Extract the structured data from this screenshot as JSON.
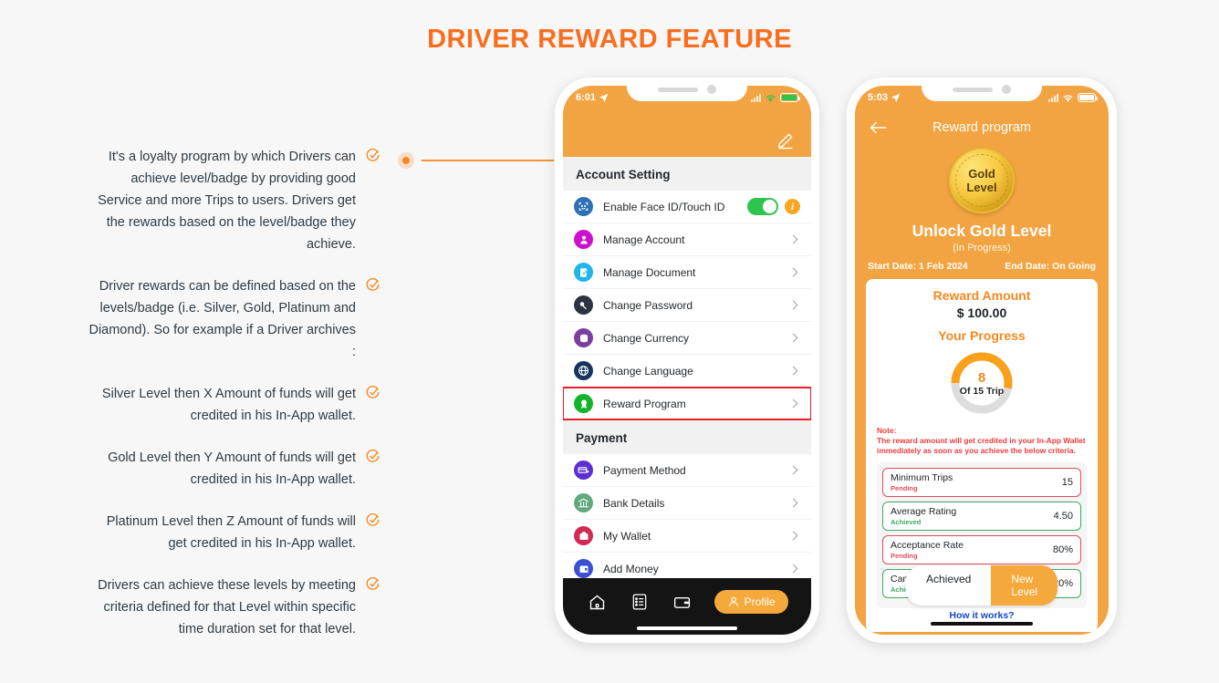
{
  "title": "DRIVER REWARD FEATURE",
  "accent_color": "#f96d1e",
  "bullets": [
    {
      "text": "It's a loyalty program by which Drivers can achieve level/badge by providing good Service and more Trips to users. Drivers get the rewards based on the level/badge they achieve."
    },
    {
      "text": "Driver rewards can be defined based on the levels/badge (i.e. Silver, Gold, Platinum and Diamond). So for example if a Driver archives :"
    },
    {
      "text": "Silver Level then X Amount of funds will get credited in his In-App wallet."
    },
    {
      "text": "Gold Level then Y Amount of funds will get credited in his In-App wallet."
    },
    {
      "text": "Platinum Level then Z Amount of funds will get credited in his In-App wallet."
    },
    {
      "text": "Drivers can achieve these levels by meeting criteria defined for that Level within specific time duration set for that level."
    }
  ],
  "phone1": {
    "status": {
      "time": "6:01",
      "battery_color": "#2ec44d"
    },
    "section1_title": "Account Setting",
    "section2_title": "Payment",
    "rows_account": [
      {
        "label": "Enable Face ID/Touch ID",
        "icon": "face-id-icon",
        "icon_color": "#2f6fb5",
        "control": "toggle"
      },
      {
        "label": "Manage Account",
        "icon": "person-icon",
        "icon_color": "#cc11cc",
        "control": "chevron"
      },
      {
        "label": "Manage Document",
        "icon": "document-edit-icon",
        "icon_color": "#1fb6ea",
        "control": "chevron"
      },
      {
        "label": "Change Password",
        "icon": "key-icon",
        "icon_color": "#2b3440",
        "control": "chevron"
      },
      {
        "label": "Change Currency",
        "icon": "currency-icon",
        "icon_color": "#7b3f9e",
        "control": "chevron"
      },
      {
        "label": "Change Language",
        "icon": "globe-icon",
        "icon_color": "#18355f",
        "control": "chevron"
      },
      {
        "label": "Reward Program",
        "icon": "reward-badge-icon",
        "icon_color": "#13b32a",
        "control": "chevron",
        "highlighted": true
      }
    ],
    "rows_payment": [
      {
        "label": "Payment Method",
        "icon": "card-swipe-icon",
        "icon_color": "#5b2fd1",
        "control": "chevron"
      },
      {
        "label": "Bank Details",
        "icon": "bank-icon",
        "icon_color": "#5fa97a",
        "control": "chevron"
      },
      {
        "label": "My Wallet",
        "icon": "wallet-icon",
        "icon_color": "#d02a55",
        "control": "chevron"
      },
      {
        "label": "Add Money",
        "icon": "add-money-icon",
        "icon_color": "#3a4fd1",
        "control": "chevron"
      }
    ],
    "tabbar": {
      "items": [
        "home-icon",
        "orders-icon",
        "wallet-icon"
      ],
      "profile_label": "Profile"
    }
  },
  "phone2": {
    "status": {
      "time": "5:03"
    },
    "nav_title": "Reward program",
    "badge_line1": "Gold",
    "badge_line2": "Level",
    "unlock_title": "Unlock Gold Level",
    "unlock_sub": "(In Progress)",
    "start_date": "Start Date: 1 Feb 2024",
    "end_date": "End Date: On Going",
    "reward_amount_label": "Reward Amount",
    "reward_amount_value": "$ 100.00",
    "progress_label": "Your Progress",
    "progress_current": "8",
    "progress_total_text": "Of 15 Trip",
    "progress_percent": 53,
    "note_title": "Note:",
    "note_text": "The reward amount will get credited in your In-App Wallet immediately as soon as you achieve the below criteria.",
    "criteria": [
      {
        "name": "Minimum Trips",
        "status": "Pending",
        "value": "15",
        "achieved": false
      },
      {
        "name": "Average Rating",
        "status": "Achieved",
        "value": "4.50",
        "achieved": true
      },
      {
        "name": "Acceptance Rate",
        "status": "Pending",
        "value": "80%",
        "achieved": false
      },
      {
        "name": "Cancellation Rate",
        "status": "Achieved",
        "value": "20%",
        "achieved": true
      }
    ],
    "how_it_works": "How it works?",
    "segmented": {
      "left": "Achieved",
      "right": "New Level"
    }
  }
}
